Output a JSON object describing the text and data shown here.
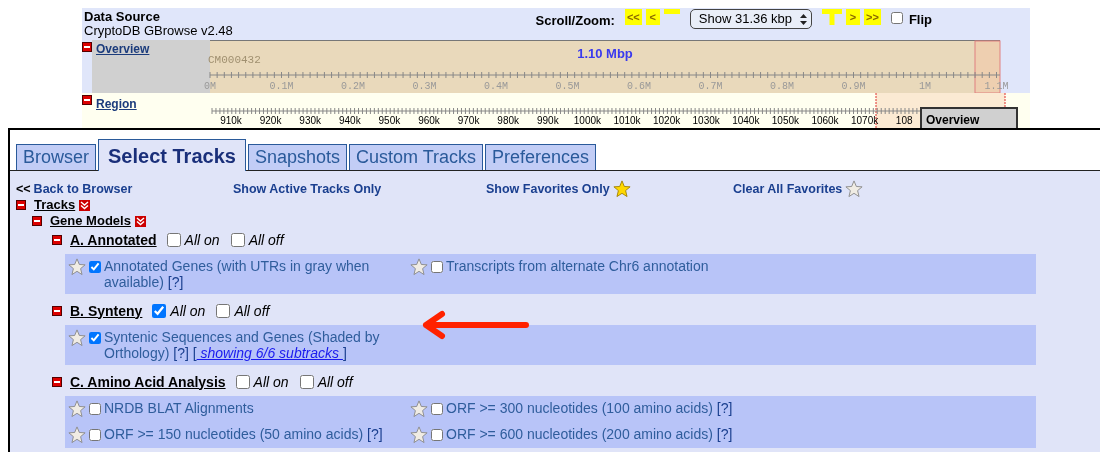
{
  "header": {
    "title": "Data Source",
    "subtitle": "CryptoDB GBrowse v2.48",
    "scroll_label": "Scroll/Zoom:",
    "nav_left": [
      {
        "kind": "text",
        "label": "<<"
      },
      {
        "kind": "text",
        "label": "<"
      },
      {
        "kind": "zoom_out"
      }
    ],
    "zoom_select": "Show 31.36 kbp",
    "nav_right": [
      {
        "kind": "zoom_in"
      },
      {
        "kind": "text",
        "label": ">"
      },
      {
        "kind": "text",
        "label": ">>"
      }
    ],
    "flip": {
      "label": "Flip",
      "checked": false
    }
  },
  "overview": {
    "label": "Overview",
    "expanded": true,
    "sequence": "CM000432",
    "span": "1.10 Mbp",
    "ticks": [
      "0M",
      "0.1M",
      "0.2M",
      "0.3M",
      "0.4M",
      "0.5M",
      "0.6M",
      "0.7M",
      "0.8M",
      "0.9M",
      "1M",
      "1.1M"
    ]
  },
  "region": {
    "label": "Region",
    "expanded": true,
    "ticks": [
      "910k",
      "920k",
      "930k",
      "940k",
      "950k",
      "960k",
      "970k",
      "980k",
      "990k",
      "1000k",
      "1010k",
      "1020k",
      "1030k",
      "1040k",
      "1050k",
      "1060k",
      "1070k",
      "108"
    ],
    "popup": "Overview"
  },
  "tabs": [
    {
      "label": "Browser",
      "selected": false
    },
    {
      "label": "Select Tracks",
      "selected": true
    },
    {
      "label": "Snapshots",
      "selected": false
    },
    {
      "label": "Custom Tracks",
      "selected": false
    },
    {
      "label": "Preferences",
      "selected": false
    }
  ],
  "links": [
    {
      "prefix": "<<",
      "label": "Back to Browser"
    },
    {
      "label": "Show Active Tracks Only"
    },
    {
      "label": "Show Favorites Only",
      "star": true,
      "starred": true
    },
    {
      "label": "Clear All Favorites",
      "star": true,
      "starred": false
    }
  ],
  "tree": {
    "label": "Tracks",
    "expanded": true,
    "menu": true,
    "children": [
      {
        "label": "Gene Models",
        "expanded": true,
        "menu": true,
        "children": [
          {
            "label": "A. Annotated",
            "expanded": true,
            "all_on": {
              "label": "All on",
              "checked": false
            },
            "all_off": {
              "label": "All off",
              "checked": false
            },
            "tracks": [
              {
                "label": "Annotated Genes (with UTRs in gray when available)",
                "help": "[?]",
                "checked": true,
                "favorite": false
              },
              {
                "label": "Transcripts from alternate Chr6 annotation",
                "checked": false,
                "favorite": false
              }
            ]
          },
          {
            "label": "B. Synteny",
            "expanded": true,
            "all_on": {
              "label": "All on",
              "checked": true
            },
            "all_off": {
              "label": "All off",
              "checked": false
            },
            "tracks": [
              {
                "label": "Syntenic Sequences and Genes (Shaded by Orthology)",
                "help": "[?]",
                "checked": true,
                "favorite": false,
                "subtracks": {
                  "open": "[",
                  "link": "showing 6/6 subtracks",
                  "close": "]"
                }
              }
            ]
          },
          {
            "label": "C. Amino Acid Analysis",
            "expanded": true,
            "all_on": {
              "label": "All on",
              "checked": false
            },
            "all_off": {
              "label": "All off",
              "checked": false
            },
            "tracks": [
              {
                "label": "NRDB BLAT Alignments",
                "checked": false,
                "favorite": false
              },
              {
                "label": "ORF >= 300 nucleotides (100 amino acids)",
                "help": "[?]",
                "checked": false,
                "favorite": false
              },
              {
                "label": "ORF >= 150 nucleotides (50 amino acids)",
                "help": "[?]",
                "checked": false,
                "favorite": false
              },
              {
                "label": "ORF >= 600 nucleotides (200 amino acids)",
                "help": "[?]",
                "checked": false,
                "favorite": false
              }
            ]
          }
        ]
      }
    ]
  }
}
